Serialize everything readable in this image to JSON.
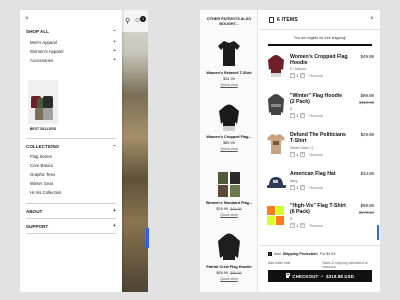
{
  "menu": {
    "close_icon": "×",
    "shop_all": "SHOP ALL",
    "shop_items": [
      "Men's Apparel",
      "Women's Apparel",
      "Accessories"
    ],
    "best_sellers": "BEST SELLERS",
    "collections": "COLLECTIONS",
    "collection_items": [
      "Flag Series",
      "Core Basics",
      "Graphic Tees",
      "Winter Gear",
      "Hi-Vis Collection"
    ],
    "about": "ABOUT",
    "support": "SUPPORT",
    "cart_count": "1"
  },
  "recommendations": {
    "title": "OTHER PATRIOTS ALSO BOUGHT...",
    "quick_view": "Quick view",
    "items": [
      {
        "name": "Women's Relaxed T-Shirt",
        "price": "$34.99",
        "old_price": "",
        "color": "#1c1c1c"
      },
      {
        "name": "Women's Cropped Flag...",
        "price": "$89.99",
        "old_price": "",
        "color": "#1a1a1a"
      },
      {
        "name": "Women's Standard Flag...",
        "price": "$29.99",
        "old_price": "$44.99",
        "color": "#4b5a3a"
      },
      {
        "name": "Patriot Crew Flag Hoodie",
        "price": "$69.99",
        "old_price": "$99.99",
        "color": "#1e1e1e"
      }
    ]
  },
  "cart": {
    "count_label": "6 ITEMS",
    "close_icon": "×",
    "free_shipping_message": "You are eligible for free shipping!",
    "items": [
      {
        "name": "Women's Cropped Flag Hoodie",
        "variant": "S / Maroon",
        "qty": "1",
        "price": "$49.99",
        "old_price": "",
        "color": "#6e1e26"
      },
      {
        "name": "\"Winter\" Flag Hoodie (2 Pack)",
        "variant": "S",
        "qty": "1",
        "price": "$99.99",
        "old_price": "$119.98",
        "color": "#444444"
      },
      {
        "name": "Defund The Politicians T-Shirt",
        "variant": "Desert Sand / S",
        "qty": "1",
        "price": "$29.99",
        "old_price": "",
        "color": "#c8a482"
      },
      {
        "name": "American Flag Hat",
        "variant": "Navy",
        "qty": "1",
        "price": "$34.99",
        "old_price": "",
        "color": "#2b3a55"
      },
      {
        "name": "\"High-Vis\" Flag T-Shirt (6 Pack)",
        "variant": "S",
        "qty": "1",
        "price": "$99.99",
        "old_price": "$179.94",
        "color": "#ff7a1a"
      }
    ],
    "remove_label": "Remove",
    "minus": "−",
    "plus": "+",
    "protection_prefix": "Add",
    "protection_bold": "Shipping Protection",
    "protection_suffix": "For $4.93",
    "order_note": "Add order note",
    "tax_note": "Taxes & shipping calculated at checkout",
    "checkout_label": "CHECKOUT",
    "checkout_separator": "•",
    "checkout_total": "$319.88 USD"
  },
  "colors": {
    "accent_blue": "#2962ff",
    "checkout_bg": "#111111"
  }
}
